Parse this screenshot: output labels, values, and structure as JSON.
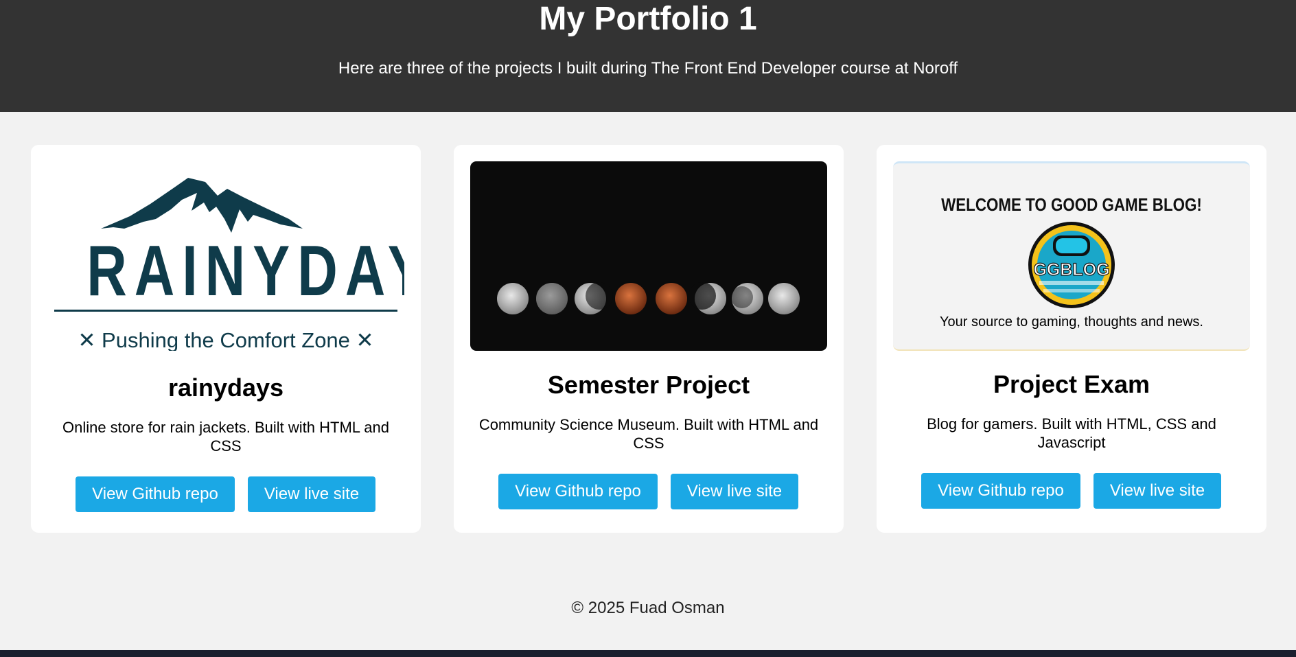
{
  "header": {
    "title": "My Portfolio 1",
    "subtitle": "Here are three of the projects I built during The Front End Developer course at Noroff"
  },
  "projects": [
    {
      "title": "rainydays",
      "description": "Online store for rain jackets. Built with HTML and CSS",
      "github_label": "View Github repo",
      "live_label": "View live site",
      "logo_word": "RAINYDAYS",
      "logo_tagline": "✕ Pushing the Comfort Zone ✕"
    },
    {
      "title": "Semester Project",
      "description": "Community Science Museum. Built with HTML and CSS",
      "github_label": "View Github repo",
      "live_label": "View live site"
    },
    {
      "title": "Project Exam",
      "description": "Blog for gamers. Built with HTML, CSS and Javascript",
      "github_label": "View Github repo",
      "live_label": "View live site",
      "image_heading": "WELCOME TO GOOD GAME BLOG!",
      "image_logo": "GGBLOG",
      "image_caption": "Your source to gaming, thoughts and news."
    }
  ],
  "footer": {
    "copyright": "© 2025 Fuad Osman"
  },
  "colors": {
    "header_bg": "#333333",
    "page_bg": "#f2f2f2",
    "button_bg": "#1ba8e5",
    "logo_navy": "#0f3b4a"
  }
}
